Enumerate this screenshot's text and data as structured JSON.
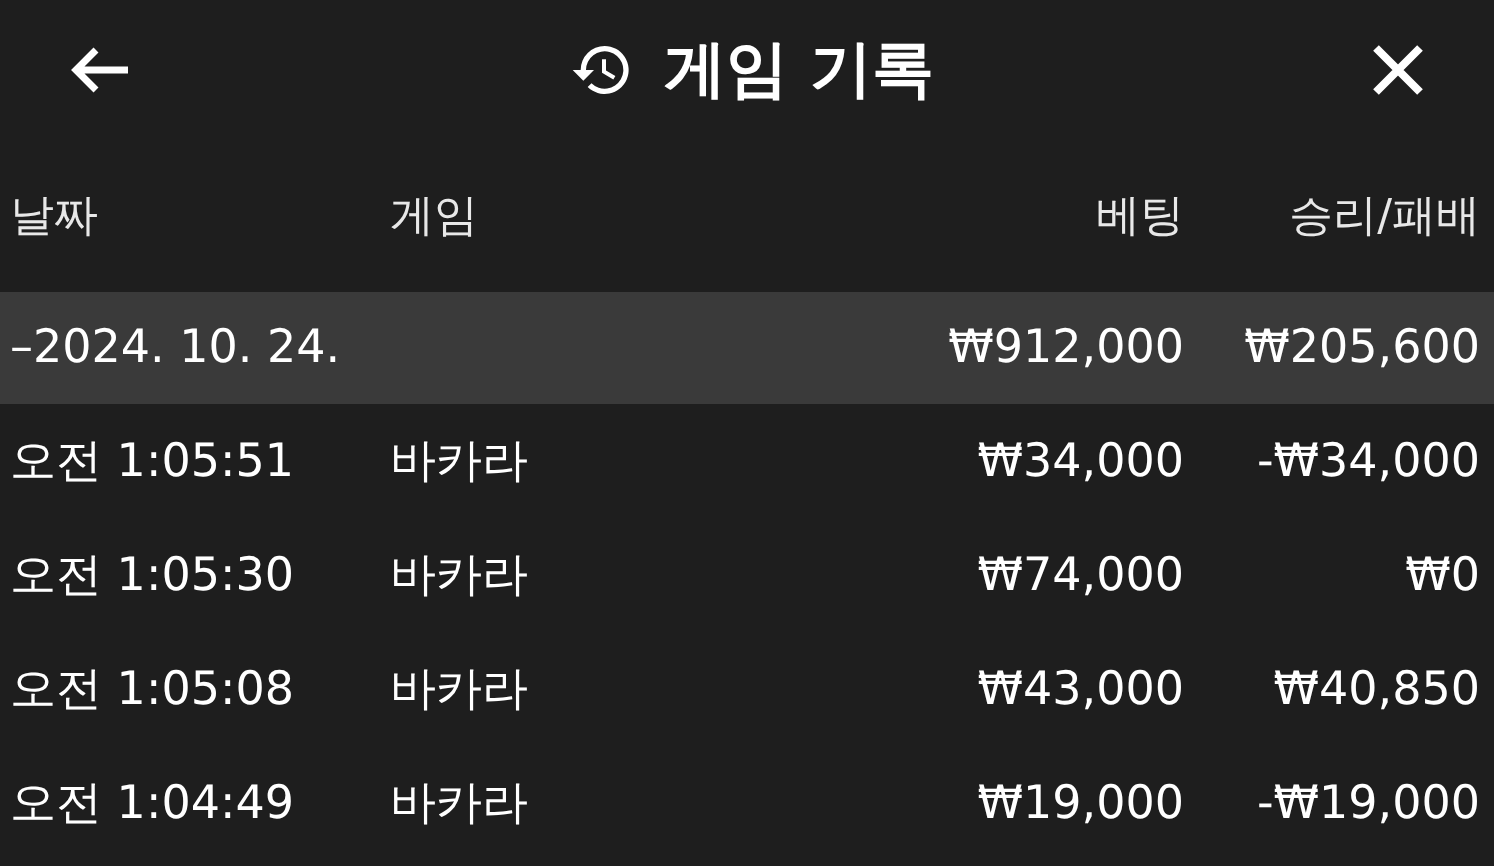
{
  "header": {
    "title": "게임 기록"
  },
  "columns": [
    "날짜",
    "게임",
    "베팅",
    "승리/패배"
  ],
  "groups": [
    {
      "date": "–2024. 10. 24.",
      "bet": "₩912,000",
      "result": "₩205,600",
      "rows": [
        {
          "time": "오전 1:05:51",
          "game": "바카라",
          "bet": "₩34,000",
          "result": "-₩34,000"
        },
        {
          "time": "오전 1:05:30",
          "game": "바카라",
          "bet": "₩74,000",
          "result": "₩0"
        },
        {
          "time": "오전 1:05:08",
          "game": "바카라",
          "bet": "₩43,000",
          "result": "₩40,850"
        },
        {
          "time": "오전 1:04:49",
          "game": "바카라",
          "bet": "₩19,000",
          "result": "-₩19,000"
        }
      ]
    }
  ]
}
